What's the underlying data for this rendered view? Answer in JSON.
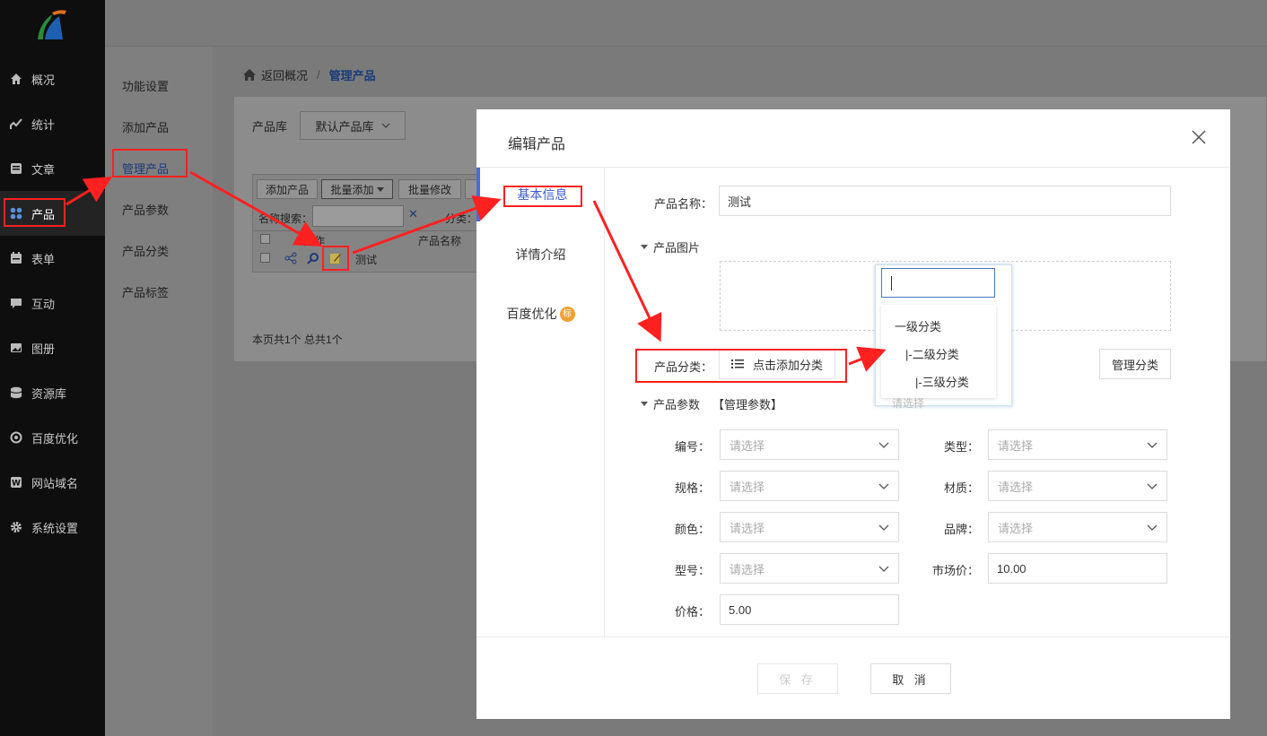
{
  "sidebar": {
    "items": [
      {
        "label": "概况",
        "icon": "home-icon"
      },
      {
        "label": "统计",
        "icon": "chart-icon"
      },
      {
        "label": "文章",
        "icon": "article-icon"
      },
      {
        "label": "产品",
        "icon": "grid-icon"
      },
      {
        "label": "表单",
        "icon": "form-icon"
      },
      {
        "label": "互动",
        "icon": "chat-icon"
      },
      {
        "label": "图册",
        "icon": "gallery-icon"
      },
      {
        "label": "资源库",
        "icon": "database-icon"
      },
      {
        "label": "百度优化",
        "icon": "target-icon"
      },
      {
        "label": "网站域名",
        "icon": "domain-icon"
      },
      {
        "label": "系统设置",
        "icon": "gear-icon"
      }
    ]
  },
  "submenu": {
    "items": [
      "功能设置",
      "添加产品",
      "管理产品",
      "产品参数",
      "产品分类",
      "产品标签"
    ]
  },
  "breadcrumb": {
    "back": "返回概况",
    "sep": "/",
    "current": "管理产品"
  },
  "library": {
    "label": "产品库",
    "value": "默认产品库"
  },
  "toolbar": {
    "add": "添加产品",
    "batch_add": "批量添加",
    "batch_edit": "批量修改"
  },
  "search": {
    "label": "名称搜索：",
    "cat_label": "分类："
  },
  "table": {
    "col_action": "操作",
    "col_name": "产品名称",
    "row_name": "测试"
  },
  "pagination": {
    "summary": "本页共1个 总共1个"
  },
  "modal": {
    "title": "编辑产品",
    "tabs": [
      "基本信息",
      "详情介绍",
      "百度优化"
    ],
    "badge": "标",
    "name_label": "产品名称：",
    "name_value": "测试",
    "image_section": "产品图片",
    "category_label": "产品分类：",
    "category_button": "点击添加分类",
    "manage_category": "管理分类",
    "param_section": "产品参数",
    "param_manage": "【管理参数】",
    "fields": [
      {
        "label": "编号：",
        "value": "请选择"
      },
      {
        "label": "类型：",
        "value": "请选择"
      },
      {
        "label": "规格：",
        "value": "请选择"
      },
      {
        "label": "材质：",
        "value": "请选择"
      },
      {
        "label": "颜色：",
        "value": "请选择"
      },
      {
        "label": "品牌：",
        "value": "请选择"
      },
      {
        "label": "型号：",
        "value": "请选择"
      },
      {
        "label": "市场价：",
        "value": "10.00"
      },
      {
        "label": "价格：",
        "value": "5.00"
      }
    ],
    "save": "保 存",
    "cancel": "取 消"
  },
  "category_popup": {
    "options": [
      "一级分类",
      "|-二级分类",
      "|-三级分类"
    ],
    "ghost": "请选择"
  },
  "colors": {
    "accent": "#3d5bd6",
    "annotation": "#ff2020"
  }
}
